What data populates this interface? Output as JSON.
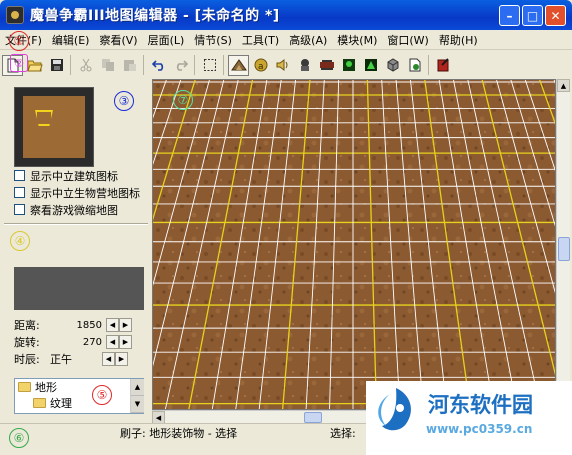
{
  "window": {
    "title": "魔兽争霸III地图编辑器 - [未命名的 *]",
    "minimize": "–",
    "maximize": "□",
    "close": "✕"
  },
  "menu": {
    "items": [
      "文件(F)",
      "编辑(E)",
      "察看(V)",
      "层面(L)",
      "情节(S)",
      "工具(T)",
      "高级(A)",
      "模块(M)",
      "窗口(W)",
      "帮助(H)"
    ]
  },
  "toolbar": {
    "buttons": [
      "new",
      "open",
      "save",
      "cut",
      "copy",
      "paste",
      "undo",
      "redo",
      "select",
      "terrain-palette",
      "doodad-palette",
      "sound-editor",
      "unit-editor",
      "object-editor",
      "trigger-editor",
      "import-manager",
      "test-map"
    ]
  },
  "annotations": {
    "c1": "①",
    "c2": "②",
    "c3": "③",
    "c4": "④",
    "c5": "⑤",
    "c6": "⑥",
    "c7": "⑦"
  },
  "left_panel": {
    "checkboxes": [
      {
        "label": "显示中立建筑图标",
        "checked": false
      },
      {
        "label": "显示中立生物营地图标",
        "checked": false
      },
      {
        "label": "察看游戏微缩地图",
        "checked": false
      }
    ],
    "params": [
      {
        "label": "距离:",
        "value": "1850"
      },
      {
        "label": "旋转:",
        "value": "270"
      },
      {
        "label": "时辰:",
        "value": "正午"
      }
    ],
    "tree": [
      {
        "label": "地形",
        "level": 0
      },
      {
        "label": "纹理",
        "level": 1
      }
    ]
  },
  "status": {
    "brush": "刷子: 地形装饰物 - 选择",
    "selection": "选择:"
  },
  "watermark": {
    "title": "河东软件园",
    "url": "www.pc0359.cn"
  },
  "colors": {
    "title_bar": "#0a4ad8",
    "terrain": "#8c5a30",
    "grid_white": "#ffffff",
    "grid_yellow": "#e6d21c"
  }
}
